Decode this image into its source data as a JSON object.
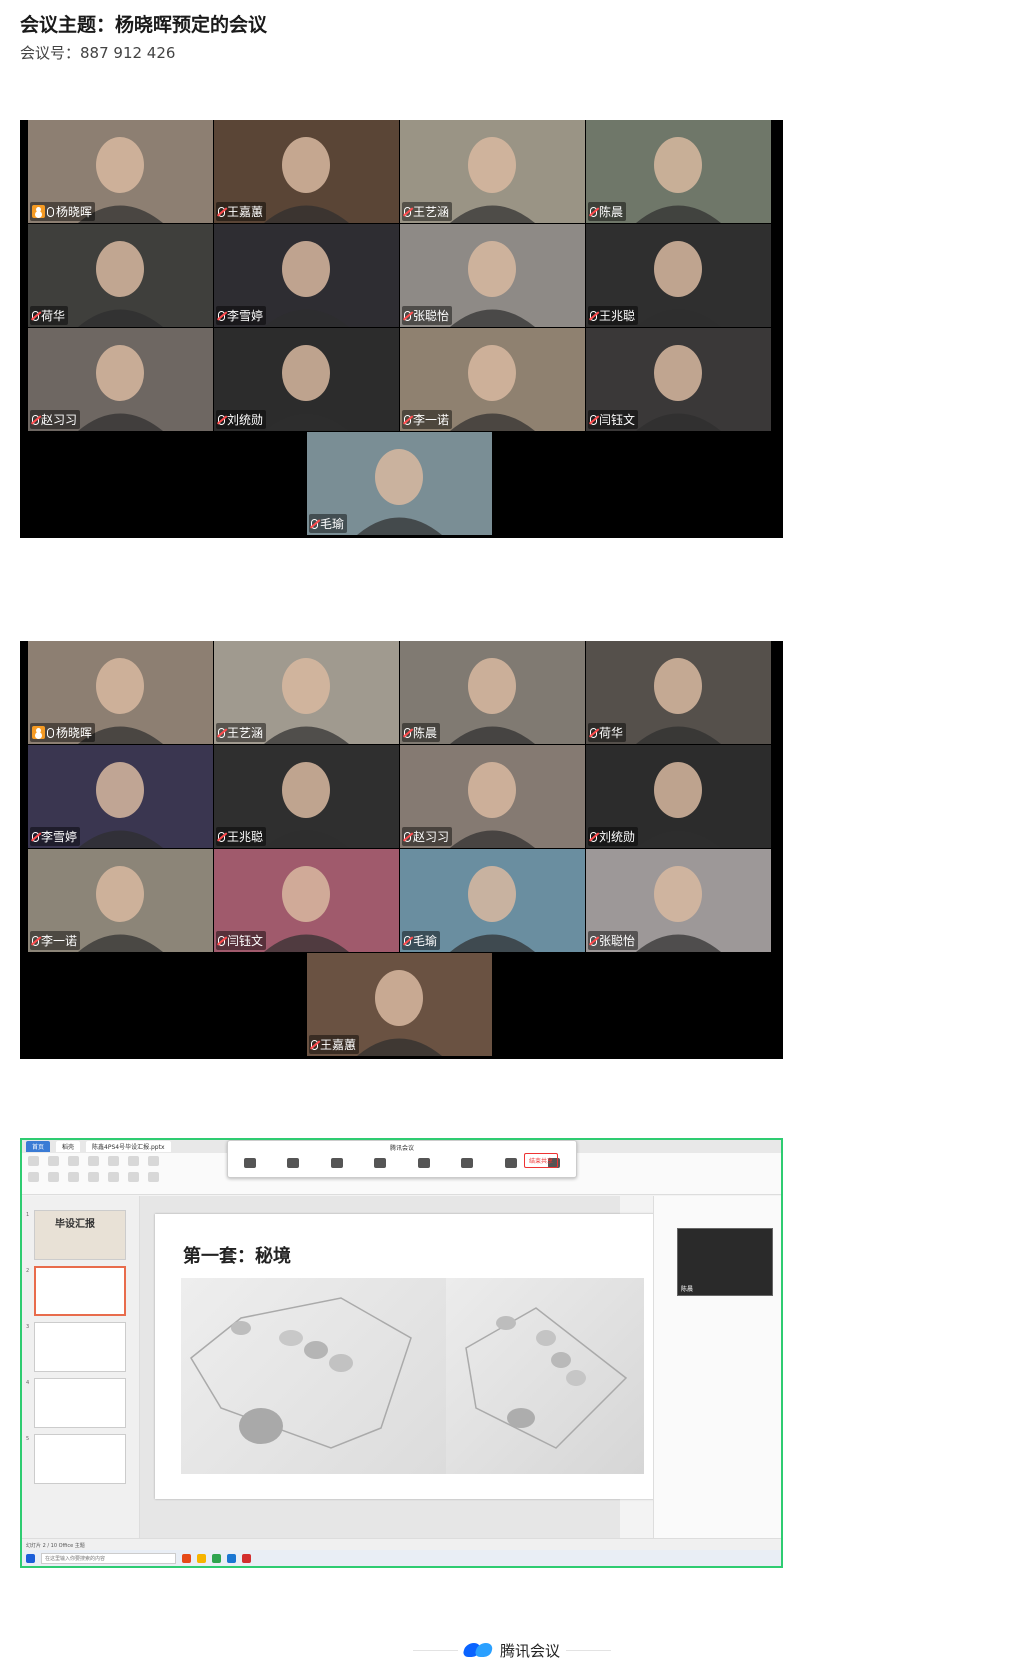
{
  "meeting": {
    "title": "会议主题：杨晓晖预定的会议",
    "id_line": "会议号：887 912 426"
  },
  "grid1": [
    {
      "name": "杨晓晖",
      "host": true,
      "active": true,
      "bg": "#8d7f72"
    },
    {
      "name": "王嘉蕙",
      "host": false,
      "active": false,
      "bg": "#5a4536"
    },
    {
      "name": "王艺涵",
      "host": false,
      "active": false,
      "bg": "#9a9485"
    },
    {
      "name": "陈晨",
      "host": false,
      "active": false,
      "bg": "#6f7769"
    },
    {
      "name": "荷华",
      "host": false,
      "active": false,
      "bg": "#3f3f3c"
    },
    {
      "name": "李雪婷",
      "host": false,
      "active": false,
      "bg": "#2e2d32"
    },
    {
      "name": "张聪怡",
      "host": false,
      "active": false,
      "bg": "#8e8a86"
    },
    {
      "name": "王兆聪",
      "host": false,
      "active": false,
      "bg": "#2f2f2f"
    },
    {
      "name": "赵习习",
      "host": false,
      "active": false,
      "bg": "#6e6762"
    },
    {
      "name": "刘统勋",
      "host": false,
      "active": false,
      "bg": "#2c2c2c"
    },
    {
      "name": "李一诺",
      "host": false,
      "active": false,
      "bg": "#8f8170"
    },
    {
      "name": "闫钰文",
      "host": false,
      "active": false,
      "bg": "#3a3838"
    },
    {
      "name": "毛瑜",
      "host": false,
      "active": false,
      "bg": "#7a8e95"
    }
  ],
  "grid2": [
    {
      "name": "杨晓晖",
      "host": true,
      "active": true,
      "bg": "#8d7f72"
    },
    {
      "name": "王艺涵",
      "host": false,
      "active": false,
      "bg": "#a09a8f"
    },
    {
      "name": "陈晨",
      "host": false,
      "active": false,
      "bg": "#807a72"
    },
    {
      "name": "荷华",
      "host": false,
      "active": false,
      "bg": "#55504b"
    },
    {
      "name": "李雪婷",
      "host": false,
      "active": false,
      "bg": "#3a3650"
    },
    {
      "name": "王兆聪",
      "host": false,
      "active": false,
      "bg": "#2f2f2f"
    },
    {
      "name": "赵习习",
      "host": false,
      "active": false,
      "bg": "#857a72"
    },
    {
      "name": "刘统勋",
      "host": false,
      "active": false,
      "bg": "#2c2c2c"
    },
    {
      "name": "李一诺",
      "host": false,
      "active": false,
      "bg": "#8c8578"
    },
    {
      "name": "闫钰文",
      "host": false,
      "active": false,
      "bg": "#a05a6c"
    },
    {
      "name": "毛瑜",
      "host": false,
      "active": false,
      "bg": "#6a8ea0"
    },
    {
      "name": "张聪怡",
      "host": false,
      "active": false,
      "bg": "#9d9898"
    },
    {
      "name": "王嘉蕙",
      "host": false,
      "active": false,
      "bg": "#6a5242"
    }
  ],
  "share": {
    "tabs": [
      "首页",
      "稻壳",
      "陈鑫4PS4号毕设汇报.pptx"
    ],
    "toolbar_title": "腾讯会议",
    "end_button": "结束共享",
    "thumb_labels": [
      "1",
      "2",
      "3",
      "4",
      "5"
    ],
    "first_thumb_text": "毕设汇报",
    "slide_title": "第一套：秘境",
    "pip_name": "陈晨",
    "status_text": "幻灯片 2 / 10    Office 主题",
    "taskbar_search": "在这里输入你要搜索的内容"
  },
  "footer": {
    "brand": "腾讯会议"
  },
  "colors": {
    "active_border": "#37c24a",
    "share_border": "#2ecc71",
    "brand_blue": "#0a63ff"
  },
  "icons": [
    "host-icon",
    "mic-icon",
    "tencent-meeting-logo-icon"
  ]
}
